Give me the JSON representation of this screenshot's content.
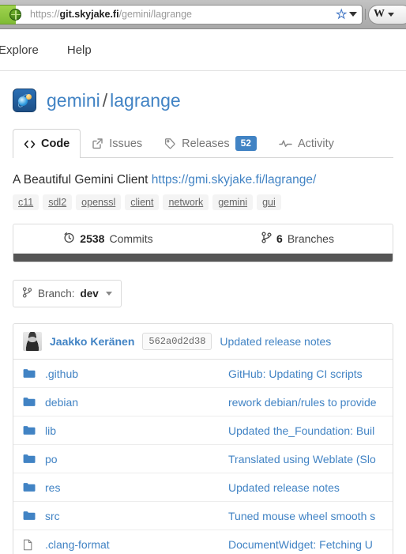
{
  "browser": {
    "url": {
      "scheme": "https://",
      "host": "git.skyjake.fi",
      "path": "/gemini/lagrange"
    },
    "bookmark_icon": "star-icon",
    "url_dropdown_icon": "chevron-down-icon",
    "search_engine_label": "W",
    "identity_icon": "globe-icon"
  },
  "site_nav": {
    "items": [
      {
        "label": "Explore"
      },
      {
        "label": "Help"
      }
    ]
  },
  "repo": {
    "owner": "gemini",
    "separator": "/",
    "name": "lagrange",
    "avatar_icon": "repo-avatar-icon",
    "description": "A Beautiful Gemini Client",
    "homepage": "https://gmi.skyjake.fi/lagrange/",
    "topics": [
      "c11",
      "sdl2",
      "openssl",
      "client",
      "network",
      "gemini",
      "gui"
    ]
  },
  "tabs": [
    {
      "label": "Code",
      "icon": "code-icon",
      "active": true,
      "badge": ""
    },
    {
      "label": "Issues",
      "icon": "external-link-icon",
      "active": false,
      "badge": ""
    },
    {
      "label": "Releases",
      "icon": "tag-icon",
      "active": false,
      "badge": "52"
    },
    {
      "label": "Activity",
      "icon": "pulse-icon",
      "active": false,
      "badge": ""
    }
  ],
  "stats": [
    {
      "icon": "clock-icon",
      "value": "2538",
      "label": "Commits"
    },
    {
      "icon": "branch-icon",
      "value": "6",
      "label": "Branches"
    }
  ],
  "language_bar_color": "#555555",
  "branch_selector": {
    "icon": "branch-icon",
    "prefix": "Branch:",
    "value": "dev",
    "caret_icon": "chevron-down-icon"
  },
  "latest_commit": {
    "avatar_icon": "user-avatar",
    "author": "Jaakko Keränen",
    "sha": "562a0d2d38",
    "message": "Updated release notes"
  },
  "files": [
    {
      "type": "folder",
      "icon": "folder-icon",
      "name": ".github",
      "message": "GitHub: Updating CI scripts"
    },
    {
      "type": "folder",
      "icon": "folder-icon",
      "name": "debian",
      "message": "rework debian/rules to provide"
    },
    {
      "type": "folder",
      "icon": "folder-icon",
      "name": "lib",
      "message": "Updated the_Foundation: Buil"
    },
    {
      "type": "folder",
      "icon": "folder-icon",
      "name": "po",
      "message": "Translated using Weblate (Slo"
    },
    {
      "type": "folder",
      "icon": "folder-icon",
      "name": "res",
      "message": "Updated release notes"
    },
    {
      "type": "folder",
      "icon": "folder-icon",
      "name": "src",
      "message": "Tuned mouse wheel smooth s"
    },
    {
      "type": "file",
      "icon": "file-icon",
      "name": ".clang-format",
      "message": "DocumentWidget: Fetching U"
    }
  ],
  "colors": {
    "link": "#4183c4",
    "badge": "#4183c4",
    "folder": "#4183c4",
    "language_bar": "#555555"
  }
}
